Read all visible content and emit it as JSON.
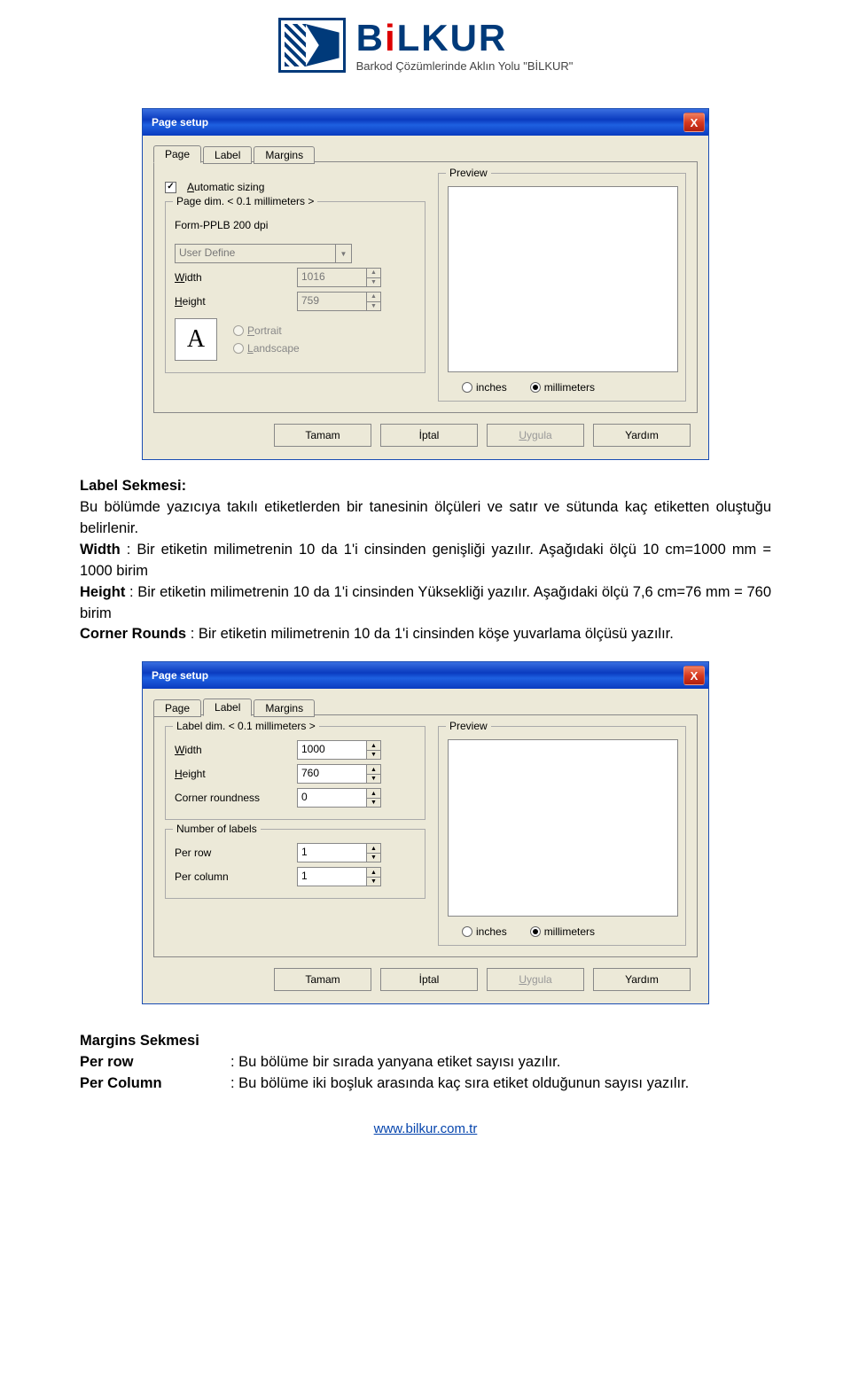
{
  "logo": {
    "title_pre": "B",
    "title_dot": "i",
    "title_post": "LKUR",
    "subtitle": "Barkod Çözümlerinde Aklın Yolu \"BİLKUR\""
  },
  "dialog1": {
    "title": "Page setup",
    "close": "X",
    "tabs": {
      "page": "Page",
      "label": "Label",
      "margins": "Margins"
    },
    "autosize": "Automatic sizing",
    "pagedim_legend": "Page dim. < 0.1 millimeters >",
    "form_text": "Form-PPLB 200 dpi",
    "user_define": "User Define",
    "width_lbl": "Width",
    "height_lbl": "Height",
    "width_val": "1016",
    "height_val": "759",
    "portrait": "Portrait",
    "landscape": "Landscape",
    "preview": "Preview",
    "inches": "inches",
    "millimeters": "millimeters",
    "buttons": {
      "ok": "Tamam",
      "cancel": "İptal",
      "apply": "Uygula",
      "help": "Yardım"
    }
  },
  "text1": {
    "heading": "Label Sekmesi:",
    "para": "Bu bölümde yazıcıya takılı etiketlerden bir tanesinin ölçüleri ve satır ve sütunda kaç etiketten oluştuğu belirlenir.",
    "width_lbl": "Width",
    "width_txt": ": Bir etiketin milimetrenin 10 da 1'i cinsinden genişliği yazılır. Aşağıdaki ölçü 10 cm=1000 mm = 1000 birim",
    "height_lbl": "Height",
    "height_txt": ": Bir etiketin milimetrenin 10 da 1'i cinsinden Yüksekliği yazılır. Aşağıdaki ölçü 7,6 cm=76 mm = 760 birim",
    "corner_lbl": "Corner Rounds",
    "corner_txt": ": Bir etiketin milimetrenin 10 da 1'i cinsinden köşe yuvarlama ölçüsü yazılır."
  },
  "dialog2": {
    "title": "Page setup",
    "close": "X",
    "tabs": {
      "page": "Page",
      "label": "Label",
      "margins": "Margins"
    },
    "labeldim_legend": "Label dim. < 0.1 millimeters >",
    "width_lbl": "Width",
    "height_lbl": "Height",
    "corner_lbl": "Corner roundness",
    "width_val": "1000",
    "height_val": "760",
    "corner_val": "0",
    "numlabels_legend": "Number of labels",
    "perrow_lbl": "Per row",
    "percol_lbl": "Per column",
    "perrow_val": "1",
    "percol_val": "1",
    "preview": "Preview",
    "inches": "inches",
    "millimeters": "millimeters",
    "buttons": {
      "ok": "Tamam",
      "cancel": "İptal",
      "apply": "Uygula",
      "help": "Yardım"
    }
  },
  "text2": {
    "heading": "Margins Sekmesi",
    "perrow_lbl": "Per row",
    "perrow_txt": ": Bu bölüme bir sırada yanyana etiket sayısı yazılır.",
    "percol_lbl": "Per Column",
    "percol_txt": ": Bu bölüme iki boşluk arasında kaç sıra etiket olduğunun sayısı yazılır."
  },
  "footer": "www.bilkur.com.tr"
}
